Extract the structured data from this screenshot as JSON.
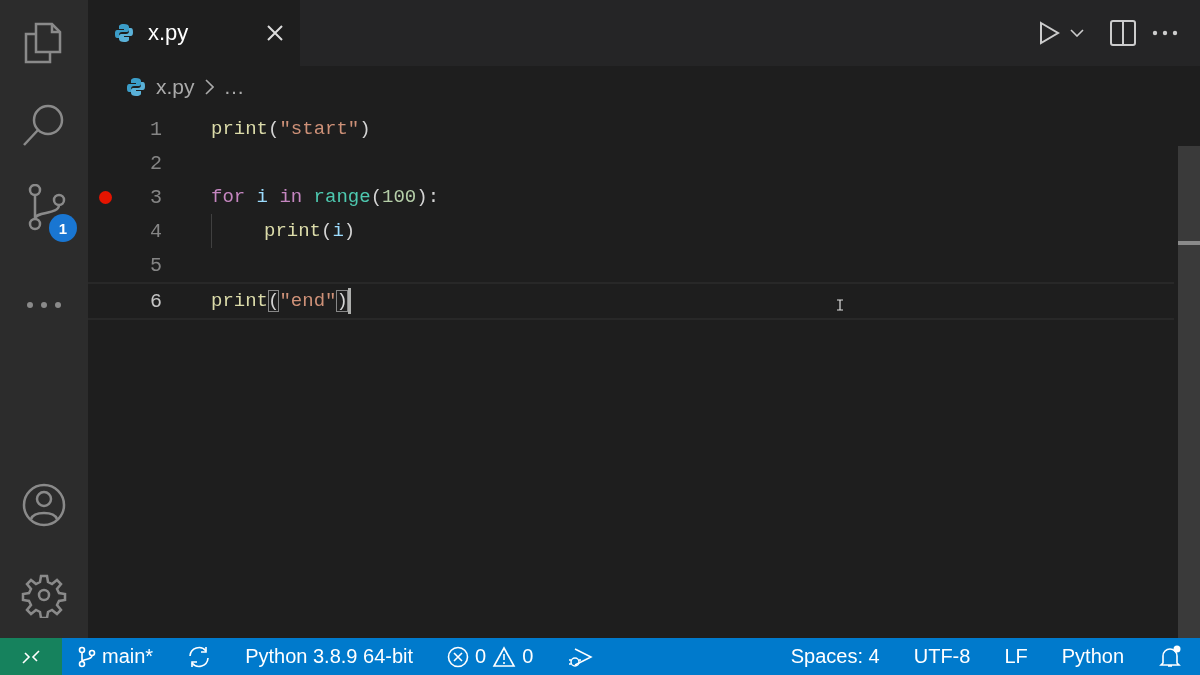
{
  "activity_bar": {
    "badge": "1"
  },
  "tabs": [
    {
      "label": "x.py",
      "selected": true
    }
  ],
  "breadcrumb": {
    "file": "x.py",
    "rest": "…"
  },
  "editor": {
    "lines": [
      {
        "number": "1",
        "breakpoint": false,
        "current": false,
        "tokens": [
          {
            "text": "print",
            "kind": "function"
          },
          {
            "text": "(",
            "kind": "punct"
          },
          {
            "text": "\"start\"",
            "kind": "string"
          },
          {
            "text": ")",
            "kind": "punct"
          }
        ]
      },
      {
        "number": "2",
        "breakpoint": false,
        "current": false
      },
      {
        "number": "3",
        "breakpoint": true,
        "current": false,
        "tokens": [
          {
            "text": "for",
            "kind": "keyword"
          },
          {
            "text": "i",
            "kind": "variable",
            "gap_before": true
          },
          {
            "text": "in",
            "kind": "keyword",
            "gap_before": true
          },
          {
            "text": "range",
            "kind": "builtin",
            "gap_before": true
          },
          {
            "text": "(",
            "kind": "punct"
          },
          {
            "text": "100",
            "kind": "number"
          },
          {
            "text": "):",
            "kind": "punct"
          }
        ]
      },
      {
        "number": "4",
        "breakpoint": false,
        "current": false,
        "indent": true,
        "tokens": [
          {
            "text": "print",
            "kind": "function"
          },
          {
            "text": "(",
            "kind": "punct"
          },
          {
            "text": "i",
            "kind": "variable"
          },
          {
            "text": ")",
            "kind": "punct"
          }
        ]
      },
      {
        "number": "5",
        "breakpoint": false,
        "current": false
      },
      {
        "number": "6",
        "breakpoint": false,
        "current": true,
        "tokens": [
          {
            "text": "print",
            "kind": "function"
          },
          {
            "text": "(",
            "kind": "matched"
          },
          {
            "text": "\"end\"",
            "kind": "string"
          },
          {
            "text": ")",
            "kind": "matched"
          }
        ]
      }
    ]
  },
  "status_bar": {
    "branch": "main*",
    "interpreter": "Python 3.8.9 64-bit",
    "errors": "0",
    "warnings": "0",
    "indentation": "Spaces: 4",
    "encoding": "UTF-8",
    "line_ending": "LF",
    "language": "Python"
  }
}
